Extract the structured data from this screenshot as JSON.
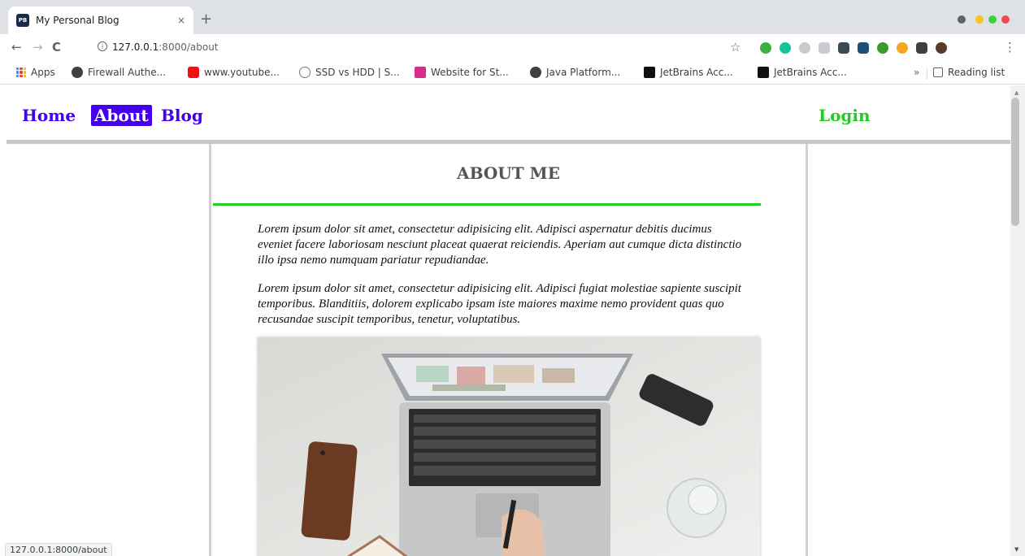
{
  "browser": {
    "tab_title": "My Personal Blog",
    "tab_favicon_text": "PB",
    "tab_close": "×",
    "new_tab": "+",
    "back": "←",
    "forward": "→",
    "reload": "C",
    "url_host": "127.0.0.1",
    "url_path": ":8000/about",
    "bookmarks": [
      {
        "label": "Apps"
      },
      {
        "label": "Firewall Authe..."
      },
      {
        "label": "www.youtube..."
      },
      {
        "label": "SSD vs HDD | S..."
      },
      {
        "label": "Website for St..."
      },
      {
        "label": "Java Platform..."
      },
      {
        "label": "JetBrains Acc..."
      },
      {
        "label": "JetBrains Acc..."
      }
    ],
    "bookmarks_overflow": "»",
    "reading_list": "Reading list",
    "status_url": "127.0.0.1:8000/about"
  },
  "nav": {
    "home": "Home",
    "about": "About",
    "blog": "Blog",
    "login": "Login"
  },
  "about": {
    "title": "ABOUT ME",
    "paragraphs": [
      "Lorem ipsum dolor sit amet, consectetur adipisicing elit. Adipisci aspernatur debitis ducimus eveniet facere laboriosam nesciunt placeat quaerat reiciendis. Aperiam aut cumque dicta distinctio illo ipsa nemo numquam pariatur repudiandae.",
      "Lorem ipsum dolor sit amet, consectetur adipisicing elit. Adipisci fugiat molestiae sapiente suscipit temporibus. Blanditiis, dolorem explicabo ipsam iste maiores maxime nemo provident quas quo recusandae suscipit temporibus, tenetur, voluptatibus."
    ]
  },
  "colors": {
    "nav_link": "#4400ee",
    "login": "#22cc22",
    "title_rule": "#22cc22"
  }
}
